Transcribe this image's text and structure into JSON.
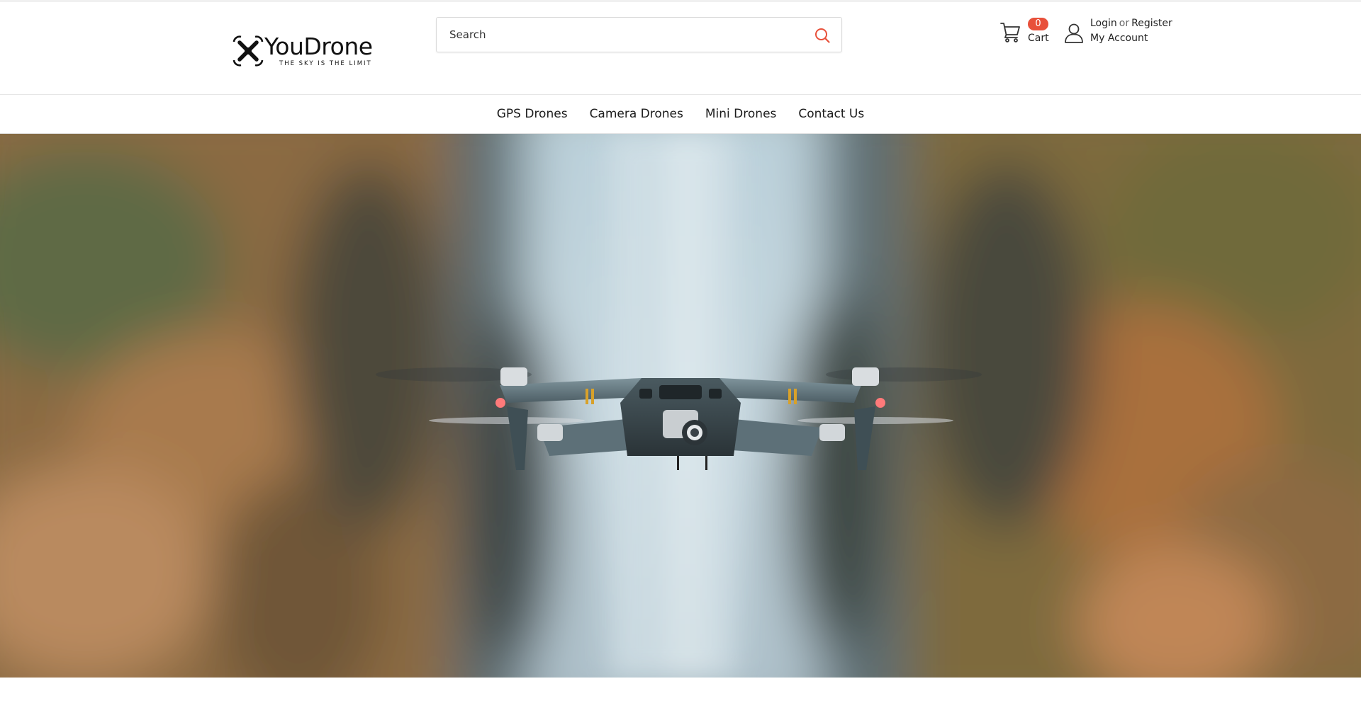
{
  "brand": {
    "name": "YouDrone",
    "tagline": "THE SKY IS THE LIMIT"
  },
  "search": {
    "placeholder": "Search",
    "value": ""
  },
  "cart": {
    "count": "0",
    "label": "Cart"
  },
  "account": {
    "login": "Login",
    "or": "or",
    "register": "Register",
    "my_account": "My Account"
  },
  "nav": {
    "items": [
      {
        "label": "GPS Drones"
      },
      {
        "label": "Camera Drones"
      },
      {
        "label": "Mini Drones"
      },
      {
        "label": "Contact Us"
      }
    ]
  },
  "colors": {
    "accent": "#e8503a",
    "text": "#1c1c1c",
    "border": "#e6e6e6"
  },
  "icons": {
    "search": "search-icon",
    "cart": "cart-icon",
    "user": "user-icon",
    "logo": "drone-logo-icon"
  }
}
